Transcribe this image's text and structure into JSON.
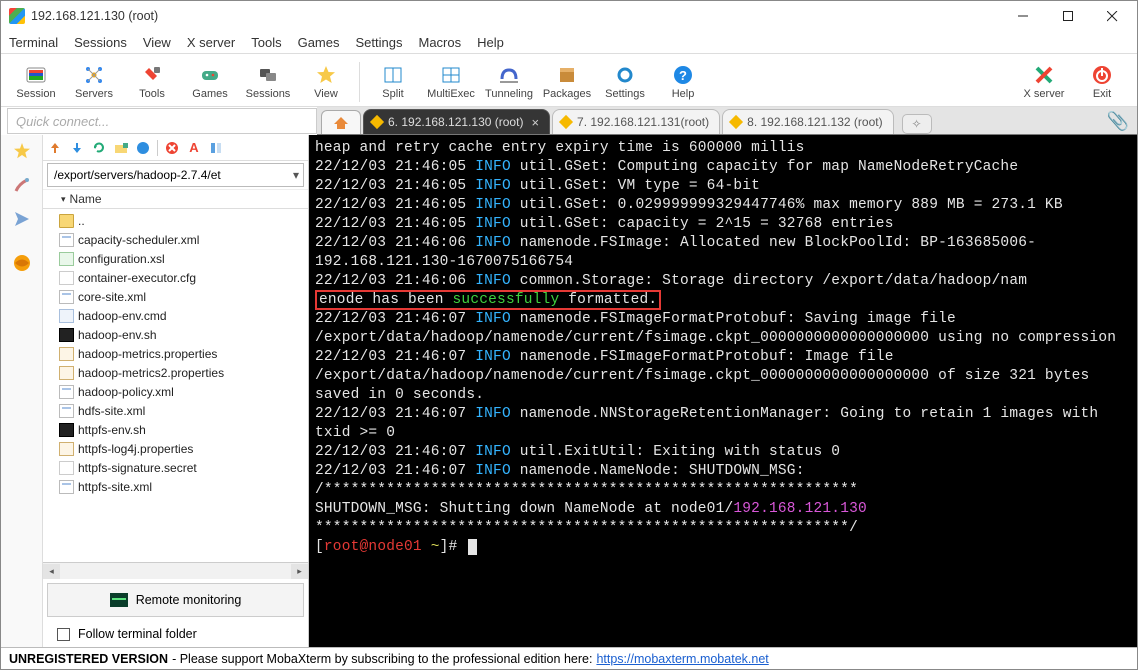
{
  "window": {
    "title": "192.168.121.130 (root)"
  },
  "menus": [
    "Terminal",
    "Sessions",
    "View",
    "X server",
    "Tools",
    "Games",
    "Settings",
    "Macros",
    "Help"
  ],
  "toolbar": [
    {
      "id": "session",
      "label": "Session"
    },
    {
      "id": "servers",
      "label": "Servers"
    },
    {
      "id": "tools",
      "label": "Tools"
    },
    {
      "id": "games",
      "label": "Games"
    },
    {
      "id": "sessions",
      "label": "Sessions"
    },
    {
      "id": "view",
      "label": "View"
    },
    {
      "id": "split",
      "label": "Split"
    },
    {
      "id": "multiexec",
      "label": "MultiExec"
    },
    {
      "id": "tunneling",
      "label": "Tunneling"
    },
    {
      "id": "packages",
      "label": "Packages"
    },
    {
      "id": "settings",
      "label": "Settings"
    },
    {
      "id": "help",
      "label": "Help"
    }
  ],
  "toolbar_right": [
    {
      "id": "xserver",
      "label": "X server"
    },
    {
      "id": "exit",
      "label": "Exit"
    }
  ],
  "quick": {
    "placeholder": "Quick connect..."
  },
  "tabs": [
    {
      "label": "6. 192.168.121.130 (root)",
      "active": true
    },
    {
      "label": "7. 192.168.121.131(root)",
      "active": false
    },
    {
      "label": "8. 192.168.121.132 (root)",
      "active": false
    }
  ],
  "sidebar": {
    "path": "/export/servers/hadoop-2.7.4/et",
    "header": "Name",
    "files": [
      {
        "icon": "folder",
        "name": ".."
      },
      {
        "icon": "xml",
        "name": "capacity-scheduler.xml"
      },
      {
        "icon": "xsl",
        "name": "configuration.xsl"
      },
      {
        "icon": "cfg",
        "name": "container-executor.cfg"
      },
      {
        "icon": "xml",
        "name": "core-site.xml"
      },
      {
        "icon": "cmd",
        "name": "hadoop-env.cmd"
      },
      {
        "icon": "sh",
        "name": "hadoop-env.sh"
      },
      {
        "icon": "prop",
        "name": "hadoop-metrics.properties"
      },
      {
        "icon": "prop",
        "name": "hadoop-metrics2.properties"
      },
      {
        "icon": "xml",
        "name": "hadoop-policy.xml"
      },
      {
        "icon": "xml",
        "name": "hdfs-site.xml"
      },
      {
        "icon": "sh",
        "name": "httpfs-env.sh"
      },
      {
        "icon": "prop",
        "name": "httpfs-log4j.properties"
      },
      {
        "icon": "secret",
        "name": "httpfs-signature.secret"
      },
      {
        "icon": "xml",
        "name": "httpfs-site.xml"
      }
    ],
    "remote_monitoring": "Remote monitoring",
    "follow": "Follow terminal folder"
  },
  "term": {
    "l1_a": "heap and retry cache entry expiry time is 600000 millis",
    "l2_a": "22/12/03 21:46:05 ",
    "l2_b": "INFO",
    "l2_c": " util.GSet: Computing capacity for map NameNodeRetryCache",
    "l3_a": "22/12/03 21:46:05 ",
    "l3_b": "INFO",
    "l3_c": " util.GSet: VM type       = 64-bit",
    "l4_a": "22/12/03 21:46:05 ",
    "l4_b": "INFO",
    "l4_c": " util.GSet: 0.029999999329447746% max memory 889 MB = 273.1 KB",
    "l5_a": "22/12/03 21:46:05 ",
    "l5_b": "INFO",
    "l5_c": " util.GSet: capacity      = 2^15 = 32768 entries",
    "l6_a": "22/12/03 21:46:06 ",
    "l6_b": "INFO",
    "l6_c": " namenode.FSImage: Allocated new BlockPoolId: BP-163685006-192.168.121.130-1670075166754",
    "l7_a": "22/12/03 21:46:06 ",
    "l7_b": "INFO",
    "l7_c": " common.Storage: Storage directory /export/data/hadoop/nam",
    "box_a": "enode has been ",
    "box_b": "successfully",
    "box_c": " formatted.",
    "l8_a": "22/12/03 21:46:07 ",
    "l8_b": "INFO",
    "l8_c": " namenode.FSImageFormatProtobuf: Saving image file /export/data/hadoop/namenode/current/fsimage.ckpt_0000000000000000000 using no compression",
    "l9_a": "22/12/03 21:46:07 ",
    "l9_b": "INFO",
    "l9_c": " namenode.FSImageFormatProtobuf: Image file /export/data/hadoop/namenode/current/fsimage.ckpt_0000000000000000000 of size 321 bytes saved in 0 seconds.",
    "l10_a": "22/12/03 21:46:07 ",
    "l10_b": "INFO",
    "l10_c": " namenode.NNStorageRetentionManager: Going to retain 1 images with txid >= 0",
    "l11_a": "22/12/03 21:46:07 ",
    "l11_b": "INFO",
    "l11_c": " util.ExitUtil: Exiting with status 0",
    "l12_a": "22/12/03 21:46:07 ",
    "l12_b": "INFO",
    "l12_c": " namenode.NameNode: SHUTDOWN_MSG:",
    "stars": "/************************************************************",
    "sd_a": "SHUTDOWN_MSG: Shutting down NameNode at node01/",
    "sd_b": "192.168.121.130",
    "stars2": "************************************************************/",
    "prompt_open": "[",
    "prompt_user": "root@node01",
    "prompt_sep": " ",
    "prompt_path": "~",
    "prompt_close": "]# "
  },
  "status": {
    "unreg": "UNREGISTERED VERSION",
    "mid": "  -  Please support MobaXterm by subscribing to the professional edition here:  ",
    "link": "https://mobaxterm.mobatek.net"
  }
}
